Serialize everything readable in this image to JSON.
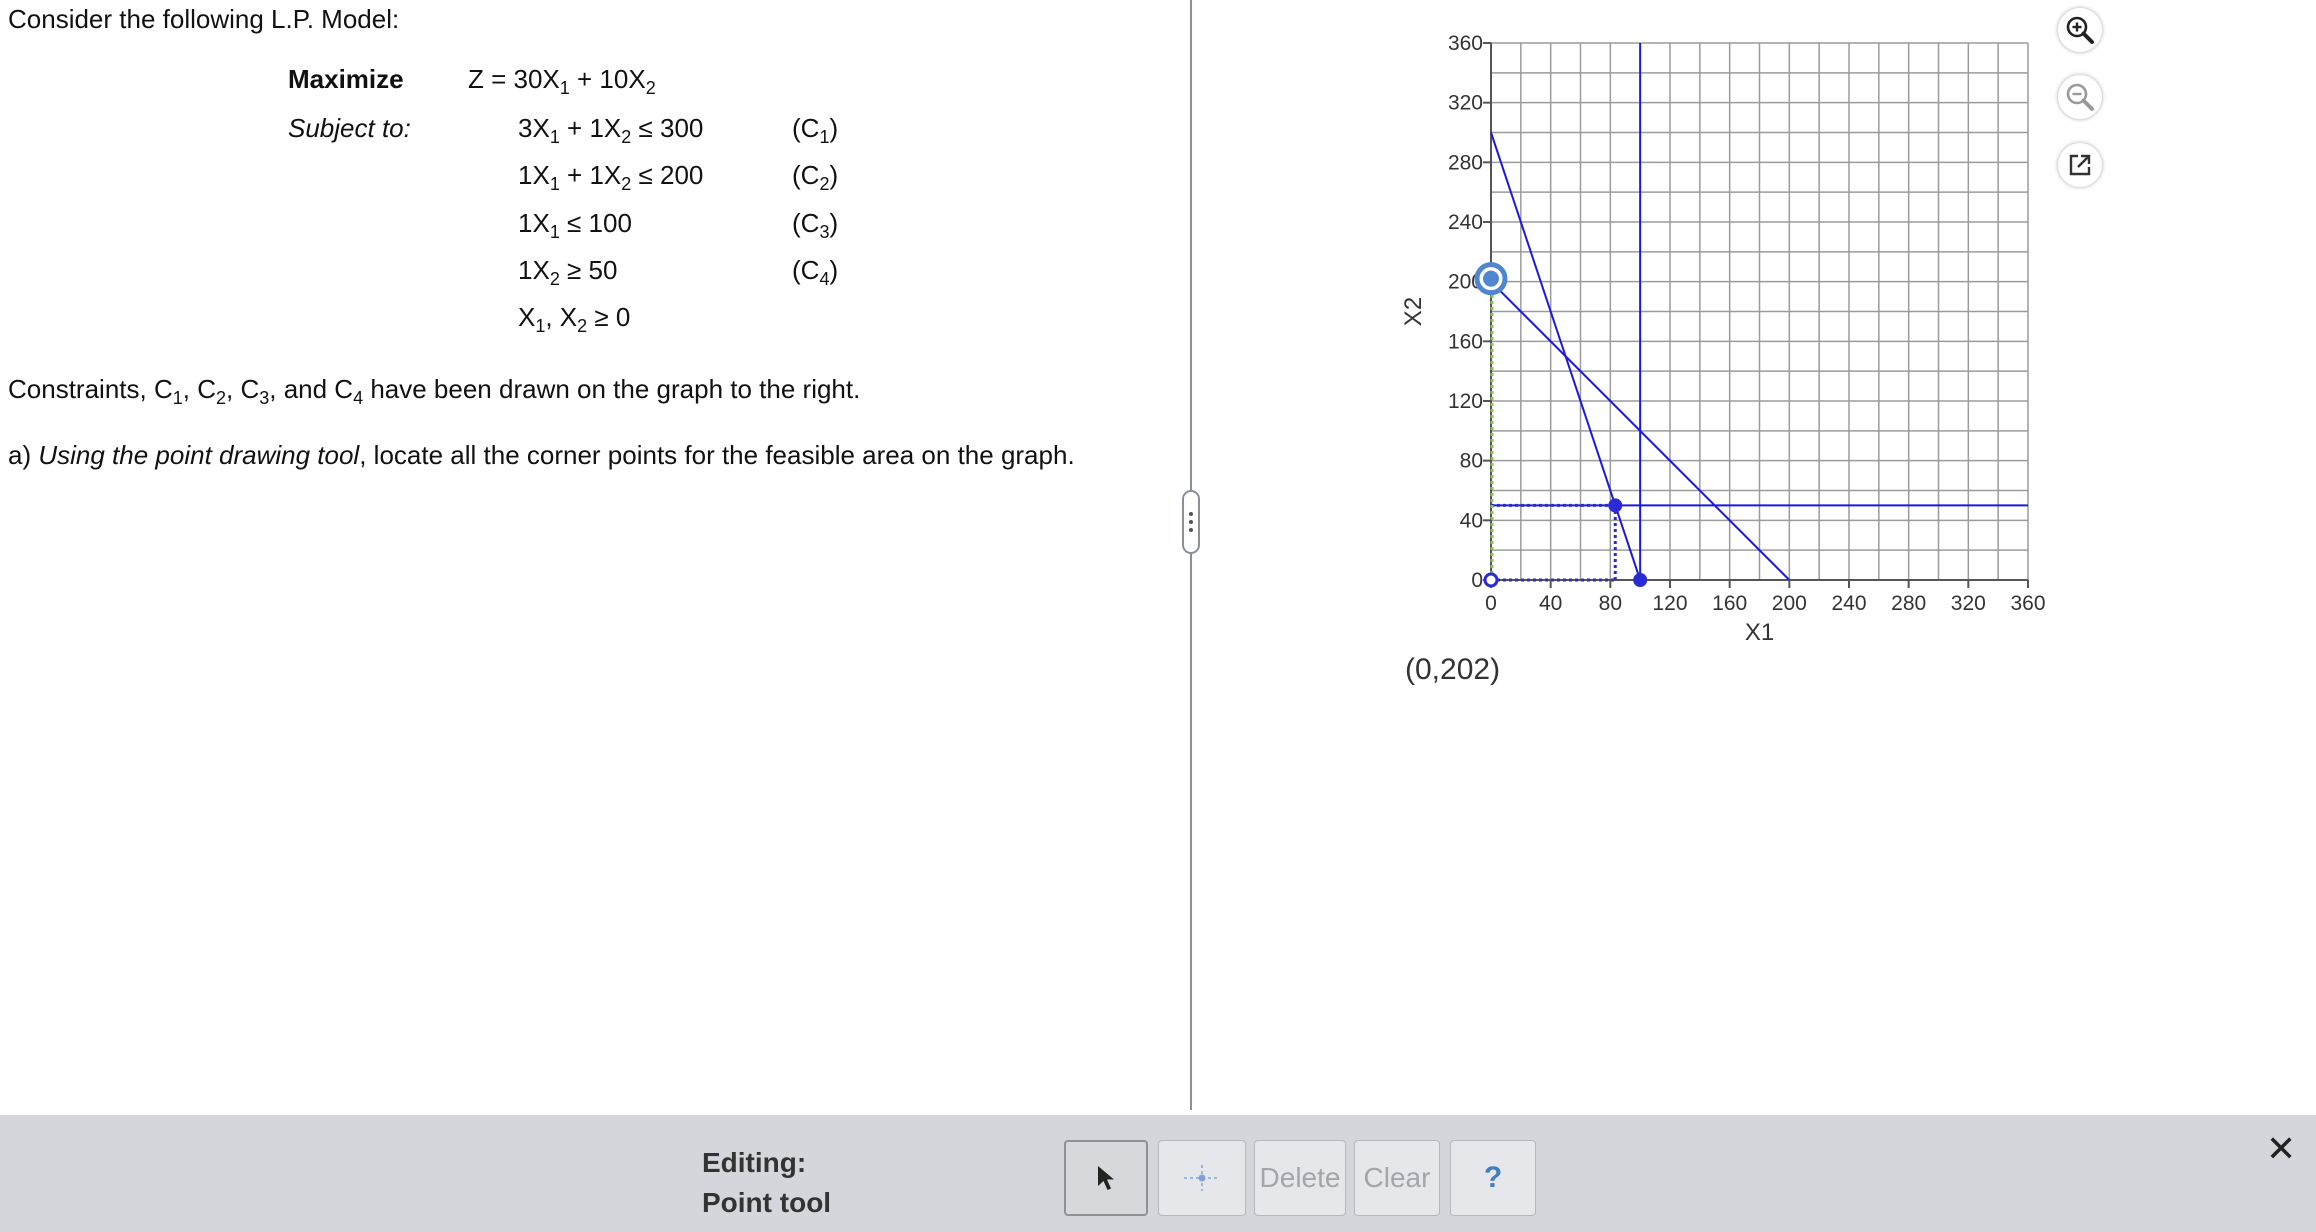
{
  "problem": {
    "intro": "Consider the following L.P. Model:",
    "maximize_label": "Maximize",
    "objective": {
      "z": "Z = 30X",
      "s1": "1",
      "mid": " + 10X",
      "s2": "2"
    },
    "subject_to_label": "Subject to:",
    "constraints": [
      {
        "parts": [
          "3X",
          "1",
          " + 1X",
          "2",
          " ≤ 300"
        ],
        "tag": "(C",
        "tag_sub": "1",
        "tag_end": ")"
      },
      {
        "parts": [
          "1X",
          "1",
          " + 1X",
          "2",
          " ≤ 200"
        ],
        "tag": "(C",
        "tag_sub": "2",
        "tag_end": ")"
      },
      {
        "parts": [
          "1X",
          "1",
          " ≤ 100"
        ],
        "tag": "(C",
        "tag_sub": "3",
        "tag_end": ")"
      },
      {
        "parts": [
          "1X",
          "2",
          " ≥ 50"
        ],
        "tag": "(C",
        "tag_sub": "4",
        "tag_end": ")"
      },
      {
        "parts": [
          "X",
          "1",
          ", X",
          "2",
          " ≥ 0"
        ]
      }
    ],
    "drawn_note": {
      "p0": "Constraints, C",
      "s1": "1",
      "p1": ", C",
      "s2": "2",
      "p2": ", C",
      "s3": "3",
      "p3": ", and  C",
      "s4": "4",
      "p4": " have been drawn on the graph to the right."
    },
    "question": {
      "prefix": "a) ",
      "italic": "Using the point drawing tool",
      "rest": ", locate all the corner points for the feasible area on the graph."
    }
  },
  "graph": {
    "readout": "(0,202)",
    "zoom_in_icon": "zoom-in-icon",
    "zoom_out_icon": "zoom-out-icon",
    "popout_icon": "popout-icon",
    "line_color": "#1a1adb",
    "point_color": "#2a2ad6",
    "selected_ring": "#4f86cf"
  },
  "chart_data": {
    "type": "scatter",
    "xlabel": "X1",
    "ylabel": "X2",
    "xlim": [
      0,
      360
    ],
    "ylim": [
      0,
      360
    ],
    "x_ticks": [
      0,
      40,
      80,
      120,
      160,
      200,
      240,
      280,
      320,
      360
    ],
    "y_ticks": [
      0,
      40,
      80,
      120,
      160,
      200,
      240,
      280,
      320,
      360
    ],
    "grid": true,
    "lines": [
      {
        "name": "C1",
        "from": [
          0,
          300
        ],
        "to": [
          100,
          0
        ]
      },
      {
        "name": "C2",
        "from": [
          0,
          200
        ],
        "to": [
          200,
          0
        ]
      },
      {
        "name": "C3",
        "from": [
          100,
          0
        ],
        "to": [
          100,
          360
        ]
      },
      {
        "name": "C4",
        "from": [
          0,
          50
        ],
        "to": [
          360,
          50
        ]
      }
    ],
    "points": [
      {
        "x": 0,
        "y": 0
      },
      {
        "x": 83.3,
        "y": 50
      },
      {
        "x": 100,
        "y": 0
      },
      {
        "x": 0,
        "y": 202,
        "selected": true
      }
    ],
    "guides": [
      {
        "from": [
          0,
          50
        ],
        "to": [
          83.3,
          50
        ]
      },
      {
        "from": [
          83.3,
          0
        ],
        "to": [
          83.3,
          50
        ]
      },
      {
        "from": [
          0,
          0
        ],
        "to": [
          83.3,
          0
        ]
      }
    ],
    "green_guide": {
      "from": [
        0,
        0
      ],
      "to": [
        0,
        202
      ]
    }
  },
  "toolbar": {
    "editing": "Editing:",
    "tool": "Point tool",
    "delete": "Delete",
    "clear": "Clear",
    "help": "?",
    "close": "✕"
  }
}
